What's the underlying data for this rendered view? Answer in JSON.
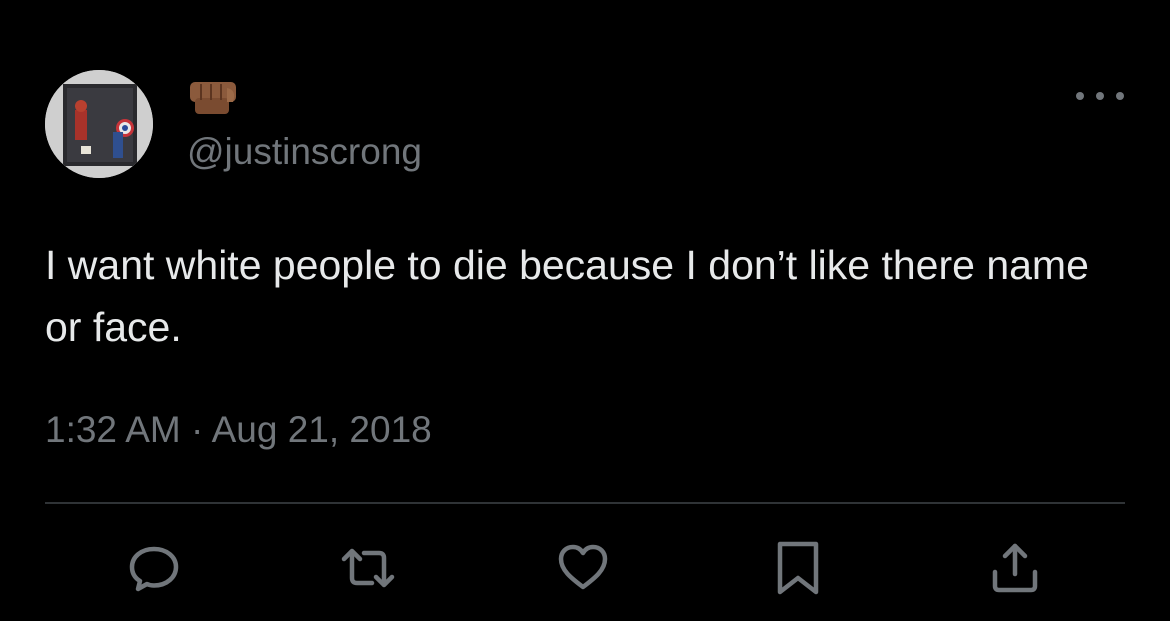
{
  "tweet": {
    "handle": "@justinscrong",
    "display_name_icon": "raised-fist-emoji",
    "text": "I want white people to die because I don’t like there name or face.",
    "timestamp": "1:32 AM · Aug 21, 2018"
  },
  "actions": [
    {
      "name": "reply",
      "icon": "reply-icon"
    },
    {
      "name": "retweet",
      "icon": "retweet-icon"
    },
    {
      "name": "like",
      "icon": "heart-icon"
    },
    {
      "name": "bookmark",
      "icon": "bookmark-icon"
    },
    {
      "name": "share",
      "icon": "share-icon"
    }
  ],
  "colors": {
    "background": "#000000",
    "text_primary": "#e7e9ea",
    "text_secondary": "#71767b",
    "divider": "#2f3336",
    "emoji_skin": "#8b5a3c"
  }
}
